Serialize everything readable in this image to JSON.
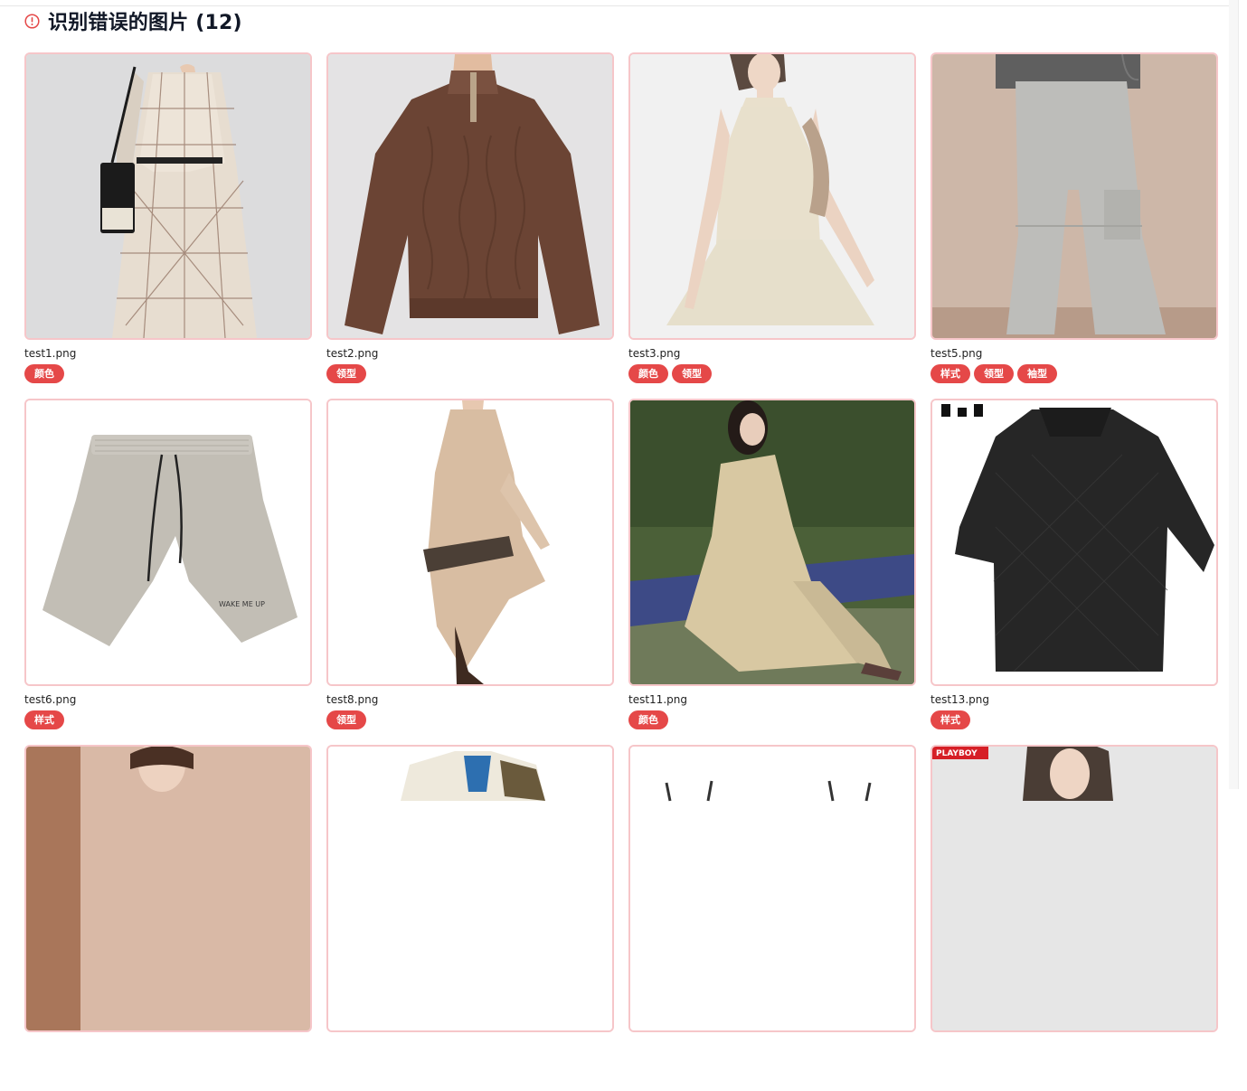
{
  "header": {
    "icon": "alert-circle-icon",
    "title": "识别错误的图片 (12)"
  },
  "colors": {
    "accent": "#e54848",
    "card_border": "#f6c6c9"
  },
  "images": [
    {
      "filename": "test1.png",
      "tags": [
        "颜色"
      ],
      "icon": "plaid-dress-photo"
    },
    {
      "filename": "test2.png",
      "tags": [
        "领型"
      ],
      "icon": "brown-knit-sweater-photo"
    },
    {
      "filename": "test3.png",
      "tags": [
        "颜色",
        "领型"
      ],
      "icon": "cream-halter-dress-photo"
    },
    {
      "filename": "test5.png",
      "tags": [
        "样式",
        "领型",
        "袖型"
      ],
      "icon": "grey-cargo-pants-photo"
    },
    {
      "filename": "test6.png",
      "tags": [
        "样式"
      ],
      "icon": "grey-shorts-photo"
    },
    {
      "filename": "test8.png",
      "tags": [
        "领型"
      ],
      "icon": "beige-chiffon-dress-photo"
    },
    {
      "filename": "test11.png",
      "tags": [
        "颜色"
      ],
      "icon": "khaki-shirt-dress-photo"
    },
    {
      "filename": "test13.png",
      "tags": [
        "样式"
      ],
      "icon": "black-textured-polo-photo"
    },
    {
      "filename": "",
      "tags": [],
      "icon": "peach-top-photo"
    },
    {
      "filename": "",
      "tags": [],
      "icon": "printed-shirt-photo"
    },
    {
      "filename": "",
      "tags": [],
      "icon": "hanger-garment-photo"
    },
    {
      "filename": "",
      "tags": [],
      "icon": "model-portrait-photo"
    }
  ],
  "partial_image_text": {
    "brand_label": "PLAYBOY",
    "shorts_print": "WAKE ME UP"
  }
}
